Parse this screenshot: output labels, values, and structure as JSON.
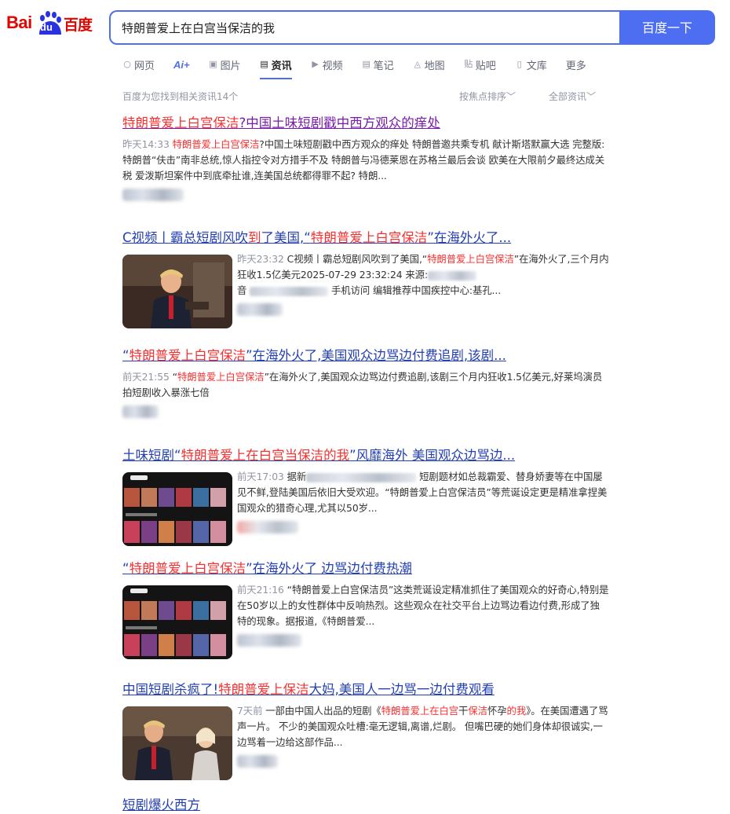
{
  "header": {
    "logo_bai": "Bai",
    "logo_du": "du",
    "logo_cn": "百度",
    "search_value": "特朗普爱上在白宫当保洁的我",
    "search_button": "百度一下"
  },
  "tabs": [
    {
      "label": "网页",
      "icon": "search-icon",
      "glyph": "○"
    },
    {
      "label": "Ai+",
      "icon": "ai-icon",
      "glyph": ""
    },
    {
      "label": "图片",
      "icon": "image-icon",
      "glyph": "▣"
    },
    {
      "label": "资讯",
      "icon": "news-icon",
      "glyph": "▤",
      "active": true
    },
    {
      "label": "视频",
      "icon": "video-icon",
      "glyph": "▶"
    },
    {
      "label": "笔记",
      "icon": "note-icon",
      "glyph": "▤"
    },
    {
      "label": "地图",
      "icon": "map-icon",
      "glyph": "◬"
    },
    {
      "label": "贴吧",
      "icon": "tieba-icon",
      "glyph": "贴"
    },
    {
      "label": "文库",
      "icon": "doc-icon",
      "glyph": "▯"
    },
    {
      "label": "更多",
      "icon": "",
      "glyph": ""
    }
  ],
  "result_info": "百度为您找到相关资讯14个",
  "sort_label": "按焦点排序",
  "filter_label": "全部资讯",
  "results": [
    {
      "title_pre": "",
      "title_hl": "特朗普爱上白宫保洁",
      "title_post": "?中国土味短剧戳中西方观众的痒处",
      "time": "昨天14:33",
      "desc_hl": "特朗普爱上白宫保洁",
      "desc": "?中国土味短剧戳中西方观众的痒处 特朗普邀共乘专机 献计斯塔默赢大选 完整版:特朗普“伕击”南非总统,惊人指控令对方措手不及 特朗普与冯德莱恩在苏格兰最后会谈 欧美在大限前夕最终达成关税 爱泼斯坦案件中到底牵扯谁,连美国总统都得罪不起? 特朗..."
    },
    {
      "title_pre": "C视频丨霸总短剧风吹",
      "title_hl1": "到",
      "title_mid": "了美国,“",
      "title_hl": "特朗普爱上白宫保洁",
      "title_post": "”在海外火了...",
      "time": "昨天23:32",
      "desc_pre": "C视频丨霸总短剧风吹到了美国,“",
      "desc_hl": "特朗普爱上白宫保洁",
      "desc": "”在海外火了,三个月内狂收1.5亿美元2025-07-29 23:32:24  来源:",
      "desc2": "音",
      "desc3": "手机访问 编辑推荐中国疾控中心:基孔..."
    },
    {
      "title_pre": "“",
      "title_hl": "特朗普爱上白宫保洁",
      "title_post": "”在海外火了,美国观众边骂边付费追剧,该剧...",
      "time": "前天21:55",
      "desc_pre": "“",
      "desc_hl": "特朗普爱上白宫保洁",
      "desc": "”在海外火了,美国观众边骂边付费追剧,该剧三个月内狂收1.5亿美元,好莱坞演员拍短剧收入暴涨七倍"
    },
    {
      "title_pre": "土味短剧“",
      "title_hl": "特朗普爱上在白宫当保洁的我",
      "title_post": "”风靡海外 美国观众边骂边...",
      "time": "前天17:03",
      "desc_pre": "据新",
      "desc": "短剧题材如总裁霸爱、替身娇妻等在中国屡见不鲜,登陆美国后依旧大受欢迎。“特朗普爱上白宫保洁员”等荒诞设定更是精准拿捏美国观众的猎奇心理,尤其以50岁..."
    },
    {
      "title_pre": "“",
      "title_hl": "特朗普爱上白宫保洁",
      "title_post": "”在海外火了 边骂边付费热潮",
      "time": "前天21:16",
      "desc": "“特朗普爱上白宫保洁员”这类荒诞设定精准抓住了美国观众的好奇心,特别是在50岁以上的女性群体中反响热烈。这些观众在社交平台上边骂边看边付费,形成了独特的现象。据报道,《特朗普爱..."
    },
    {
      "title_pre": "中国短剧杀疯了!",
      "title_hl": "特朗普爱上保洁",
      "title_post": "大妈,美国人一边骂一边付费观看",
      "time": "7天前",
      "desc_pre": "一部由中国人出品的短剧《",
      "desc_hl": "特朗普爱上在白宫",
      "desc_mid": "干",
      "desc_hl2": "保洁",
      "desc_mid2": "怀孕",
      "desc_hl3": "的我",
      "desc": "》。在美国遭遇了骂声一片。 不少的美国观众吐槽:毫无逻辑,离谱,烂剧。 但嘴巴硬的她们身体却很诚实,一边骂着一边给这部作品..."
    }
  ],
  "partial_next_title": "短剧爆火西方"
}
